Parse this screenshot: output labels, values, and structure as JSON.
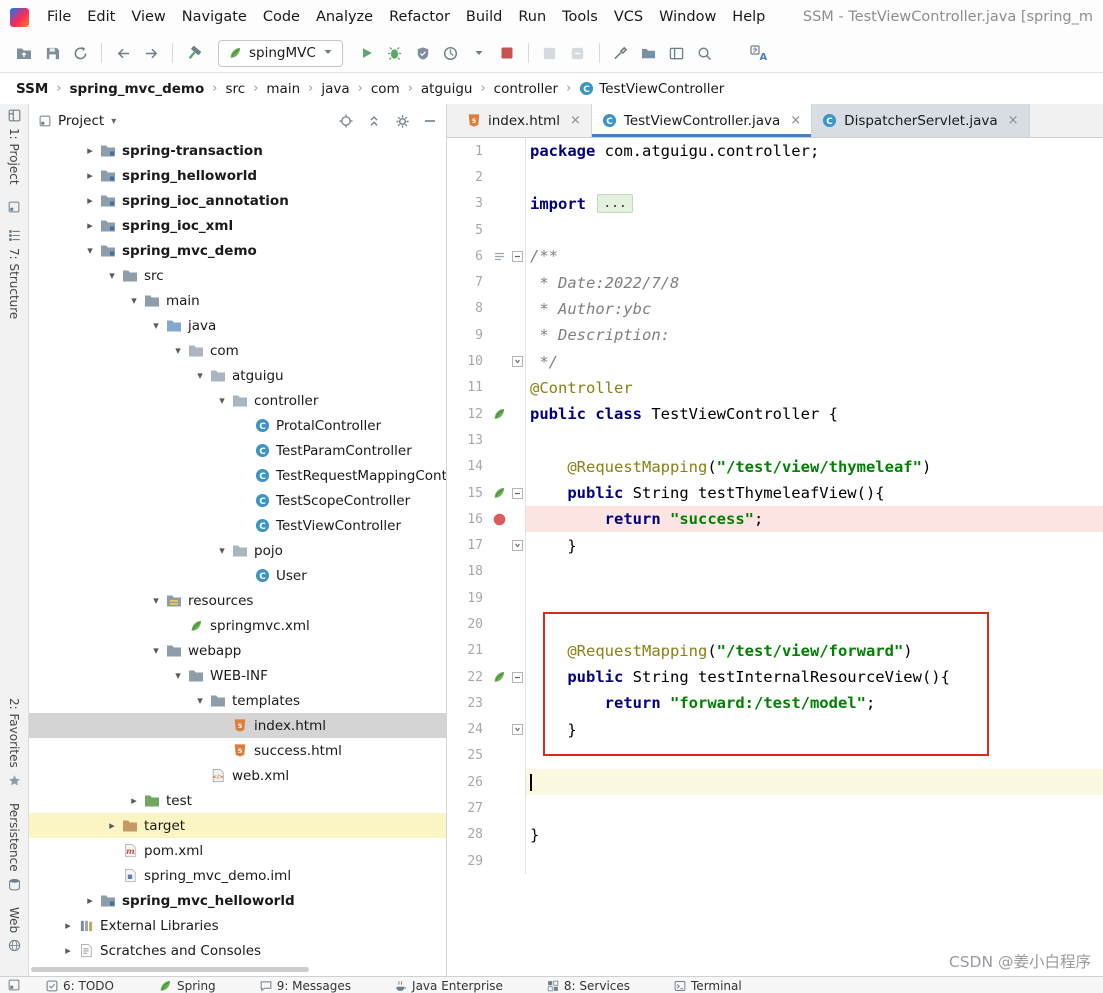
{
  "window_title": "SSM - TestViewController.java [spring_m",
  "menu": {
    "items": [
      "File",
      "Edit",
      "View",
      "Navigate",
      "Code",
      "Analyze",
      "Refactor",
      "Build",
      "Run",
      "Tools",
      "VCS",
      "Window",
      "Help"
    ]
  },
  "toolbar": {
    "run_config_label": "spingMVC",
    "items": [
      {
        "t": "icon",
        "name": "open"
      },
      {
        "t": "icon",
        "name": "save"
      },
      {
        "t": "icon",
        "name": "sync"
      },
      {
        "t": "sep"
      },
      {
        "t": "icon",
        "name": "back"
      },
      {
        "t": "icon",
        "name": "forward"
      },
      {
        "t": "sep"
      },
      {
        "t": "icon",
        "name": "build"
      },
      {
        "t": "runconfig"
      },
      {
        "t": "icon",
        "name": "run"
      },
      {
        "t": "icon",
        "name": "debug"
      },
      {
        "t": "icon",
        "name": "coverage"
      },
      {
        "t": "icon",
        "name": "profiler"
      },
      {
        "t": "icon",
        "name": "chevron-down"
      },
      {
        "t": "icon",
        "name": "stop"
      },
      {
        "t": "sep"
      },
      {
        "t": "icon",
        "name": "grayed-1"
      },
      {
        "t": "icon",
        "name": "grayed-2"
      },
      {
        "t": "sep"
      },
      {
        "t": "icon",
        "name": "tools"
      },
      {
        "t": "icon",
        "name": "project-structure"
      },
      {
        "t": "icon",
        "name": "layout"
      },
      {
        "t": "icon",
        "name": "search"
      },
      {
        "t": "gap"
      },
      {
        "t": "icon",
        "name": "translate"
      }
    ]
  },
  "breadcrumb": {
    "items": [
      {
        "label": "SSM",
        "bold": true
      },
      {
        "label": "spring_mvc_demo",
        "bold": true
      },
      {
        "label": "src"
      },
      {
        "label": "main"
      },
      {
        "label": "java"
      },
      {
        "label": "com"
      },
      {
        "label": "atguigu"
      },
      {
        "label": "controller"
      },
      {
        "label": "TestViewController",
        "icon": "class"
      }
    ]
  },
  "stripe": {
    "top": [
      {
        "label": "1: Project",
        "icon": "project-tool"
      },
      {
        "icon": "window-mini"
      },
      {
        "label": "7: Structure",
        "icon": "structure-tool"
      }
    ],
    "bottom": [
      {
        "label": "2: Favorites",
        "icon": "star"
      },
      {
        "label": "Persistence",
        "icon": "persistence-tool"
      },
      {
        "label": "Web",
        "icon": "web-tool"
      }
    ]
  },
  "project": {
    "title": "Project",
    "tree": [
      {
        "d": 1,
        "arrow": "r",
        "icon": "module",
        "label": "spring-transaction",
        "bold": true
      },
      {
        "d": 1,
        "arrow": "r",
        "icon": "module",
        "label": "spring_helloworld",
        "bold": true
      },
      {
        "d": 1,
        "arrow": "r",
        "icon": "module",
        "label": "spring_ioc_annotation",
        "bold": true
      },
      {
        "d": 1,
        "arrow": "r",
        "icon": "module",
        "label": "spring_ioc_xml",
        "bold": true
      },
      {
        "d": 1,
        "arrow": "d",
        "icon": "module",
        "label": "spring_mvc_demo",
        "bold": true
      },
      {
        "d": 2,
        "arrow": "d",
        "icon": "folder",
        "label": "src"
      },
      {
        "d": 3,
        "arrow": "d",
        "icon": "folder",
        "label": "main"
      },
      {
        "d": 4,
        "arrow": "d",
        "icon": "folder-src",
        "label": "java"
      },
      {
        "d": 5,
        "arrow": "d",
        "icon": "package",
        "label": "com"
      },
      {
        "d": 6,
        "arrow": "d",
        "icon": "package",
        "label": "atguigu"
      },
      {
        "d": 7,
        "arrow": "d",
        "icon": "package",
        "label": "controller"
      },
      {
        "d": 8,
        "icon": "class",
        "label": "ProtalController"
      },
      {
        "d": 8,
        "icon": "class",
        "label": "TestParamController"
      },
      {
        "d": 8,
        "icon": "class",
        "label": "TestRequestMappingCont"
      },
      {
        "d": 8,
        "icon": "class",
        "label": "TestScopeController"
      },
      {
        "d": 8,
        "icon": "class",
        "label": "TestViewController"
      },
      {
        "d": 7,
        "arrow": "d",
        "icon": "package",
        "label": "pojo"
      },
      {
        "d": 8,
        "icon": "class",
        "label": "User"
      },
      {
        "d": 4,
        "arrow": "d",
        "icon": "folder-res",
        "label": "resources"
      },
      {
        "d": 5,
        "icon": "spring-cfg",
        "label": "springmvc.xml"
      },
      {
        "d": 4,
        "arrow": "d",
        "icon": "folder",
        "label": "webapp"
      },
      {
        "d": 5,
        "arrow": "d",
        "icon": "folder",
        "label": "WEB-INF"
      },
      {
        "d": 6,
        "arrow": "d",
        "icon": "folder",
        "label": "templates"
      },
      {
        "d": 7,
        "icon": "html",
        "label": "index.html",
        "selected": true
      },
      {
        "d": 7,
        "icon": "html",
        "label": "success.html"
      },
      {
        "d": 6,
        "icon": "xml-web",
        "label": "web.xml"
      },
      {
        "d": 3,
        "arrow": "r",
        "icon": "folder-test",
        "label": "test"
      },
      {
        "d": 2,
        "arrow": "r",
        "icon": "folder-target",
        "label": "target",
        "rowbg": "yellow"
      },
      {
        "d": 2,
        "icon": "maven",
        "label": "pom.xml"
      },
      {
        "d": 2,
        "icon": "iml",
        "label": "spring_mvc_demo.iml"
      },
      {
        "d": 1,
        "arrow": "r",
        "icon": "module",
        "label": "spring_mvc_helloworld",
        "bold": true
      },
      {
        "d": 0,
        "arrow": "r",
        "icon": "lib",
        "label": "External Libraries"
      },
      {
        "d": 0,
        "arrow": "r",
        "icon": "scratch",
        "label": "Scratches and Consoles"
      }
    ]
  },
  "tabs": [
    {
      "label": "index.html",
      "icon": "html",
      "close": true
    },
    {
      "label": "TestViewController.java",
      "icon": "class",
      "close": true,
      "active": true
    },
    {
      "label": "DispatcherServlet.java",
      "icon": "class",
      "close": true,
      "shaded": true
    }
  ],
  "editor": {
    "lines": [
      {
        "n": 1,
        "seg": [
          [
            "k",
            "package"
          ],
          [
            "p",
            " com.atguigu.controller;"
          ]
        ]
      },
      {
        "n": 2,
        "seg": []
      },
      {
        "n": 3,
        "seg": [
          [
            "k",
            "import"
          ],
          [
            "p",
            " "
          ],
          [
            "fold",
            "..."
          ]
        ]
      },
      {
        "n": 5,
        "seg": []
      },
      {
        "n": 6,
        "fm": "start",
        "gut": "lines",
        "seg": [
          [
            "c",
            "/**"
          ]
        ]
      },
      {
        "n": 7,
        "seg": [
          [
            "c",
            " * Date:2022/7/8"
          ]
        ]
      },
      {
        "n": 8,
        "seg": [
          [
            "c",
            " * Author:ybc"
          ]
        ]
      },
      {
        "n": 9,
        "seg": [
          [
            "c",
            " * Description:"
          ]
        ]
      },
      {
        "n": 10,
        "fm": "end",
        "seg": [
          [
            "c",
            " */"
          ]
        ]
      },
      {
        "n": 11,
        "seg": [
          [
            "a",
            "@Controller"
          ]
        ]
      },
      {
        "n": 12,
        "gut": "spring",
        "seg": [
          [
            "k",
            "public"
          ],
          [
            "p",
            " "
          ],
          [
            "k",
            "class"
          ],
          [
            "p",
            " TestViewController {"
          ]
        ]
      },
      {
        "n": 13,
        "seg": []
      },
      {
        "n": 14,
        "seg": [
          [
            "p",
            "    "
          ],
          [
            "a",
            "@RequestMapping"
          ],
          [
            "p",
            "("
          ],
          [
            "s",
            "\"/test/view/thymeleaf\""
          ],
          [
            "p",
            ")"
          ]
        ]
      },
      {
        "n": 15,
        "gut": "spring",
        "fm": "start",
        "seg": [
          [
            "p",
            "    "
          ],
          [
            "k",
            "public"
          ],
          [
            "p",
            " String "
          ],
          [
            "m",
            "testThymeleafView"
          ],
          [
            "p",
            "(){"
          ]
        ]
      },
      {
        "n": 16,
        "gut": "breakpoint",
        "bg": "pink",
        "seg": [
          [
            "p",
            "        "
          ],
          [
            "k",
            "return"
          ],
          [
            "p",
            " "
          ],
          [
            "s",
            "\"success\""
          ],
          [
            "p",
            ";"
          ]
        ]
      },
      {
        "n": 17,
        "fm": "end",
        "seg": [
          [
            "p",
            "    }"
          ]
        ]
      },
      {
        "n": 18,
        "seg": []
      },
      {
        "n": 19,
        "seg": []
      },
      {
        "n": 20,
        "seg": []
      },
      {
        "n": 21,
        "seg": [
          [
            "p",
            "    "
          ],
          [
            "a",
            "@RequestMapping"
          ],
          [
            "p",
            "("
          ],
          [
            "s",
            "\"/test/view/forward\""
          ],
          [
            "p",
            ")"
          ]
        ]
      },
      {
        "n": 22,
        "gut": "spring",
        "fm": "start",
        "seg": [
          [
            "p",
            "    "
          ],
          [
            "k",
            "public"
          ],
          [
            "p",
            " String "
          ],
          [
            "m",
            "testInternalResourceView"
          ],
          [
            "p",
            "(){"
          ]
        ]
      },
      {
        "n": 23,
        "seg": [
          [
            "p",
            "        "
          ],
          [
            "k",
            "return"
          ],
          [
            "p",
            " "
          ],
          [
            "s",
            "\"forward:/test/model\""
          ],
          [
            "p",
            ";"
          ]
        ]
      },
      {
        "n": 24,
        "fm": "end",
        "seg": [
          [
            "p",
            "    }"
          ]
        ]
      },
      {
        "n": 25,
        "seg": []
      },
      {
        "n": 26,
        "bg": "yellow",
        "cursor": true,
        "seg": []
      },
      {
        "n": 27,
        "seg": []
      },
      {
        "n": 28,
        "seg": [
          [
            "p",
            "}"
          ]
        ]
      },
      {
        "n": 29,
        "seg": []
      }
    ]
  },
  "status": {
    "items": [
      {
        "label": "6: TODO",
        "icon": "todo"
      },
      {
        "label": "Spring",
        "icon": "spring-leaf"
      },
      {
        "label": "9: Messages",
        "icon": "messages"
      },
      {
        "label": "Java Enterprise",
        "icon": "javaee"
      },
      {
        "label": "8: Services",
        "icon": "services"
      },
      {
        "label": "Terminal",
        "icon": "terminal"
      }
    ]
  },
  "watermark": "CSDN @姜小白程序",
  "colors": {
    "accent": "#4083C9",
    "breakpoint_line": "#FBE4E1",
    "caret_line": "#FCF9E3",
    "annotation_box": "#CF2E21",
    "selected_row": "#D4D4D4",
    "marked_row": "#FBF5C3"
  }
}
